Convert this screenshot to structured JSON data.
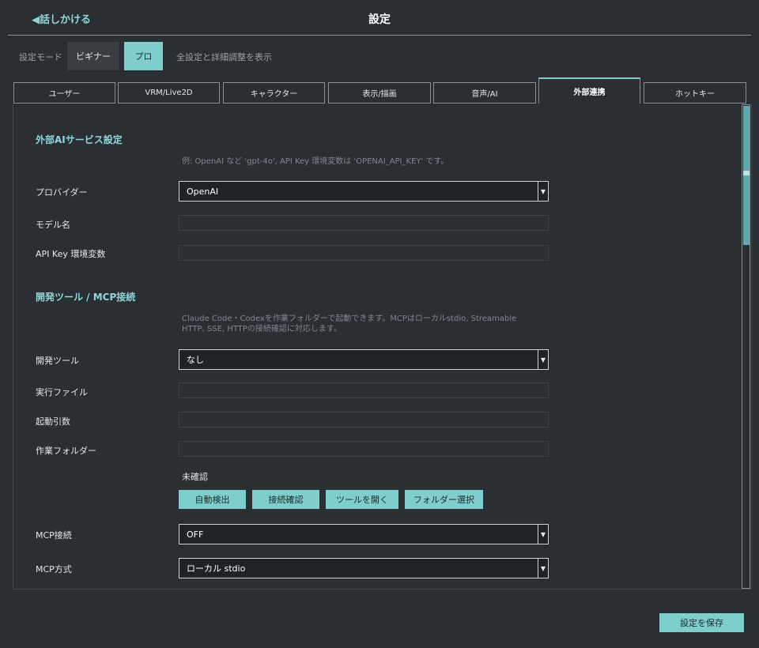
{
  "header": {
    "back_label": "◀話しかける",
    "title": "設定"
  },
  "mode": {
    "label": "設定モード",
    "options": [
      "ビギナー",
      "プロ"
    ],
    "selected": "プロ",
    "description": "全設定と詳細調整を表示"
  },
  "tabs": [
    "ユーザー",
    "VRM/Live2D",
    "キャラクター",
    "表示/描画",
    "音声/AI",
    "外部連携",
    "ホットキー"
  ],
  "active_tab": "外部連携",
  "ai_section": {
    "title": "外部AIサービス設定",
    "hint": "例: OpenAI など 'gpt-4o', API Key 環境変数は 'OPENAI_API_KEY' です。",
    "provider_label": "プロバイダー",
    "provider_value": "OpenAI",
    "model_label": "モデル名",
    "model_value": "",
    "apikey_label": "API Key 環境変数",
    "apikey_value": ""
  },
  "dev_section": {
    "title": "開発ツール / MCP接続",
    "hint_line1": "Claude Code・Codexを作業フォルダーで起動できます。MCPはローカルstdio, Streamable",
    "hint_line2": "HTTP, SSE, HTTPの接続確認に対応します。",
    "tool_label": "開発ツール",
    "tool_value": "なし",
    "exe_label": "実行ファイル",
    "exe_value": "",
    "args_label": "起動引数",
    "args_value": "",
    "folder_label": "作業フォルダー",
    "folder_value": "",
    "status": "未確認",
    "buttons": [
      "自動検出",
      "接続確認",
      "ツールを開く",
      "フォルダー選択"
    ],
    "mcp_label": "MCP接続",
    "mcp_value": "OFF",
    "mcp_mode_label": "MCP方式",
    "mcp_mode_value": "ローカル stdio"
  },
  "footer": {
    "save_label": "設定を保存"
  },
  "colors": {
    "accent": "#7fcdcd",
    "background": "#2b2e33",
    "section_title": "#8fd6d6"
  }
}
